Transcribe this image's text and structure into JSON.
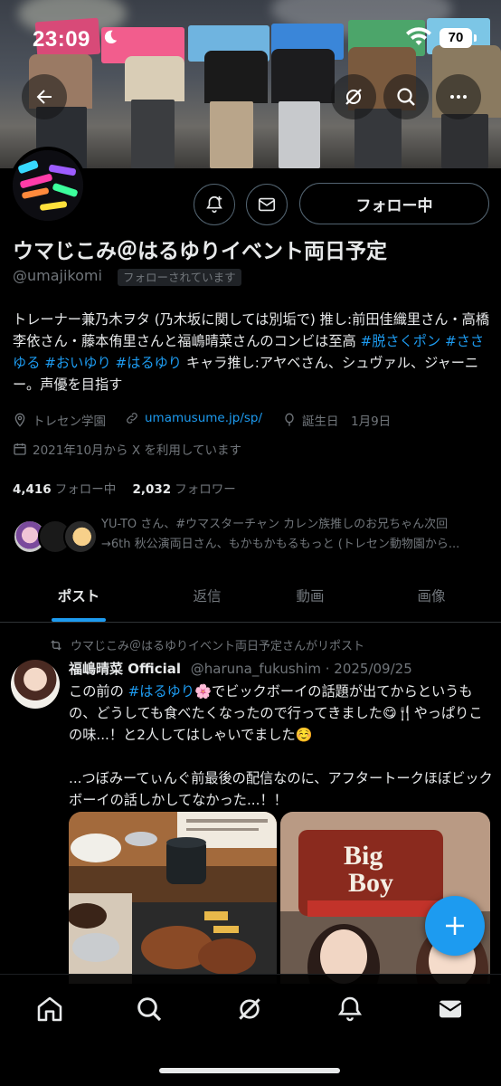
{
  "status_bar": {
    "time": "23:09",
    "battery": "70"
  },
  "profile": {
    "display_name": "ウマじこみ＠はるゆりイベント両日予定",
    "handle": "@umajikomi",
    "follows_you_badge": "フォローされています",
    "follow_button": "フォロー中",
    "bio": {
      "line1_text": "トレーナー兼乃木ヲタ (乃木坂に関しては別垢で) 推し:前田佳織里さん・高橋李依さん・藤本侑里さんと福嶋晴菜さんのコンビは至高 ",
      "tag1": "#脱さくポン",
      "tag2": "#ささゆる",
      "tag3": "#おいゆり",
      "tag4": "#はるゆり",
      "tail_text": " キャラ推し:アヤベさん、シュヴァル、ジャーニー。声優を目指す"
    },
    "location": "トレセン学園",
    "website": "umamusume.jp/sp/",
    "birthday": "誕生日　1月9日",
    "joined": "2021年10月から X を利用しています",
    "following_count": "4,416",
    "following_label": "フォロー中",
    "followers_count": "2,032",
    "followers_label": "フォロワー",
    "followed_by_line1": "YU-TO さん、#ウマスターチャン カレン族推しのお兄ちゃん次回",
    "followed_by_line2": "→6th 秋公演両日さん、もかもかもるもっと (トレセン動物園から..."
  },
  "tabs": [
    {
      "label": "ポスト",
      "active": true
    },
    {
      "label": "返信",
      "active": false
    },
    {
      "label": "動画",
      "active": false
    },
    {
      "label": "画像",
      "active": false
    }
  ],
  "post": {
    "repost_note": "ウマじこみ＠はるゆりイベント両日予定さんがリポスト",
    "author_name": "福嶋晴菜 Official",
    "author_handle_date": "@haruna_fukushim · 2025/09/25",
    "line1_pre": "この前の ",
    "line1_tag": "#はるゆり",
    "line1_post": "🌸でビックボーイの話題が出てからというもの、どうしても食べたくなったので行ってきました😋🍴やっぱりこの味...！と2人してはしゃいでました☺️",
    "paragraph2": "...つぼみーてぃんぐ前最後の配信なのに、アフタートークほぼビックボーイの話しかしてなかった...！！",
    "sign_big": "Big",
    "sign_boy": "Boy"
  },
  "colors": {
    "accent": "#1d9bf0",
    "text_primary": "#e7e9ea",
    "text_secondary": "#71767b",
    "border": "#2f3336",
    "background": "#000000"
  },
  "icons": {
    "back": "arrow-left-icon",
    "grok": "grok-icon",
    "search": "search-icon",
    "more": "more-horizontal-icon",
    "notify": "bell-plus-icon",
    "message": "envelope-icon",
    "location": "location-pin-icon",
    "link": "link-icon",
    "birthday": "balloon-icon",
    "calendar": "calendar-icon",
    "repost": "repost-icon",
    "compose": "plus-icon",
    "nav_home": "home-icon",
    "nav_search": "search-icon",
    "nav_grok": "grok-icon",
    "nav_notifications": "bell-icon",
    "nav_messages": "envelope-icon"
  }
}
